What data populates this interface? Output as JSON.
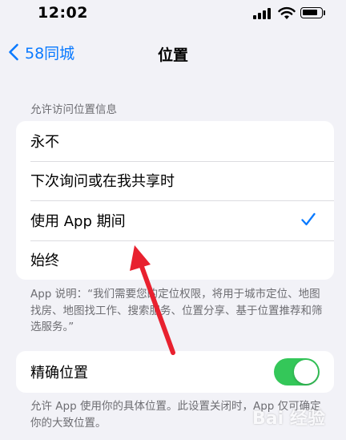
{
  "status": {
    "time": "12:02"
  },
  "nav": {
    "back_label": "58同城",
    "title": "位置"
  },
  "location_access": {
    "header": "允许访问位置信息",
    "options": [
      {
        "label": "永不",
        "selected": false
      },
      {
        "label": "下次询问或在我共享时",
        "selected": false
      },
      {
        "label": "使用 App 期间",
        "selected": true
      },
      {
        "label": "始终",
        "selected": false
      }
    ],
    "footer": "App 说明：“我们需要您的定位权限，将用于城市定位、地图找房、地图找工作、搜索服务、位置分享、基于位置推荐和筛选服务。”"
  },
  "precise_location": {
    "label": "精确位置",
    "enabled": true,
    "footer": "允许 App 使用你的具体位置。此设置关闭时，App 仅可确定你的大致位置。"
  },
  "colors": {
    "accent": "#0a7aff",
    "toggle_on": "#34c759",
    "arrow": "#e8212f",
    "background": "#f2f2f7"
  },
  "watermark": {
    "text": "Bai 经验"
  }
}
